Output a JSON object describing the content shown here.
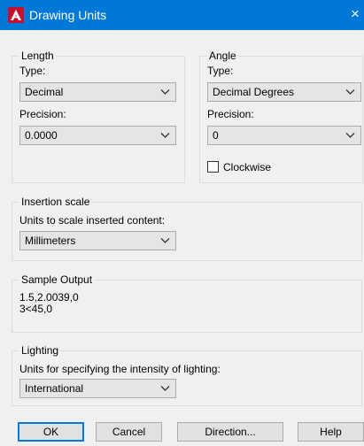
{
  "window": {
    "title": "Drawing Units",
    "close_glyph": "×"
  },
  "length": {
    "group_label": "Length",
    "type_label": "Type:",
    "type_value": "Decimal",
    "precision_label": "Precision:",
    "precision_value": "0.0000"
  },
  "angle": {
    "group_label": "Angle",
    "type_label": "Type:",
    "type_value": "Decimal Degrees",
    "precision_label": "Precision:",
    "precision_value": "0",
    "clockwise_label": "Clockwise",
    "clockwise_checked": false
  },
  "insertion": {
    "group_label": "Insertion scale",
    "units_label": "Units to scale inserted content:",
    "units_value": "Millimeters"
  },
  "sample": {
    "group_label": "Sample Output",
    "line1": "1.5,2.0039,0",
    "line2": "3<45,0"
  },
  "lighting": {
    "group_label": "Lighting",
    "units_label": "Units for specifying the intensity of lighting:",
    "units_value": "International"
  },
  "buttons": {
    "ok": "OK",
    "cancel": "Cancel",
    "direction": "Direction...",
    "help": "Help"
  },
  "colors": {
    "titlebar": "#0078d7",
    "autocad_red": "#c8102e"
  }
}
